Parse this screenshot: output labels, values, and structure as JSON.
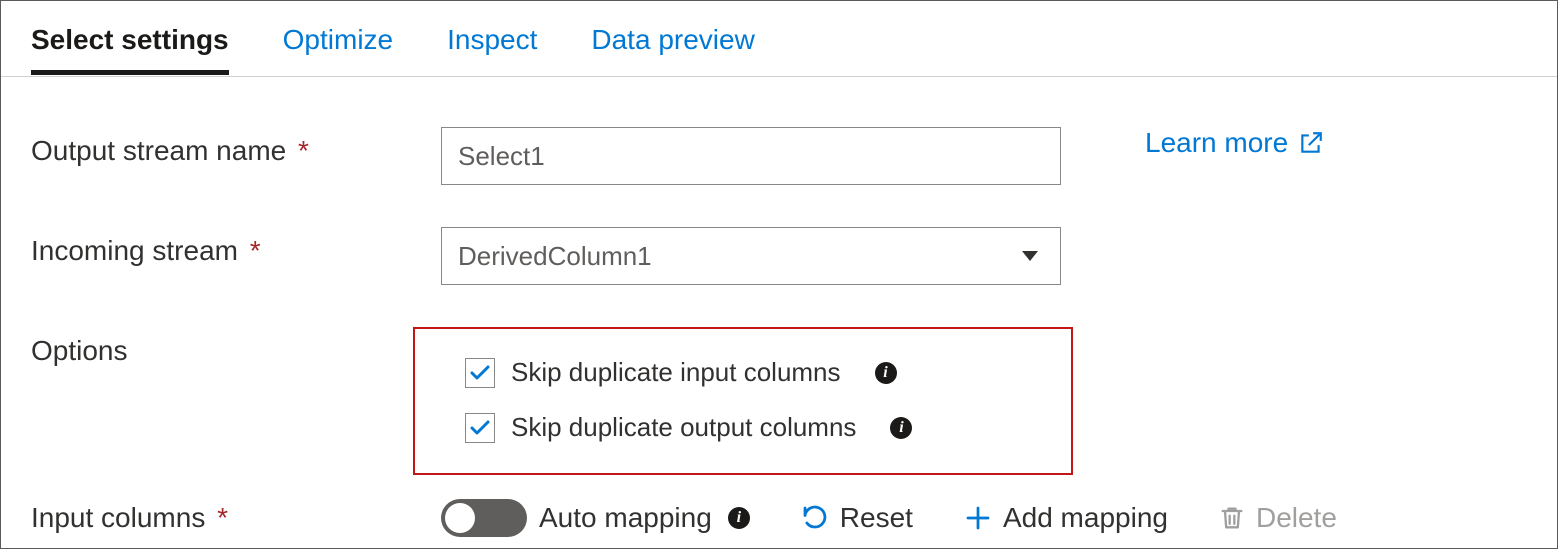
{
  "tabs": {
    "select_settings": "Select settings",
    "optimize": "Optimize",
    "inspect": "Inspect",
    "data_preview": "Data preview"
  },
  "labels": {
    "output_stream_name": "Output stream name",
    "incoming_stream": "Incoming stream",
    "options": "Options",
    "input_columns": "Input columns"
  },
  "fields": {
    "output_stream_value": "Select1",
    "incoming_stream_value": "DerivedColumn1"
  },
  "options": {
    "skip_input": "Skip duplicate input columns",
    "skip_output": "Skip duplicate output columns"
  },
  "controls": {
    "auto_mapping": "Auto mapping",
    "reset": "Reset",
    "add_mapping": "Add mapping",
    "delete": "Delete"
  },
  "links": {
    "learn_more": "Learn more"
  },
  "colors": {
    "accent": "#0078d4",
    "highlight_border": "#c01818"
  }
}
